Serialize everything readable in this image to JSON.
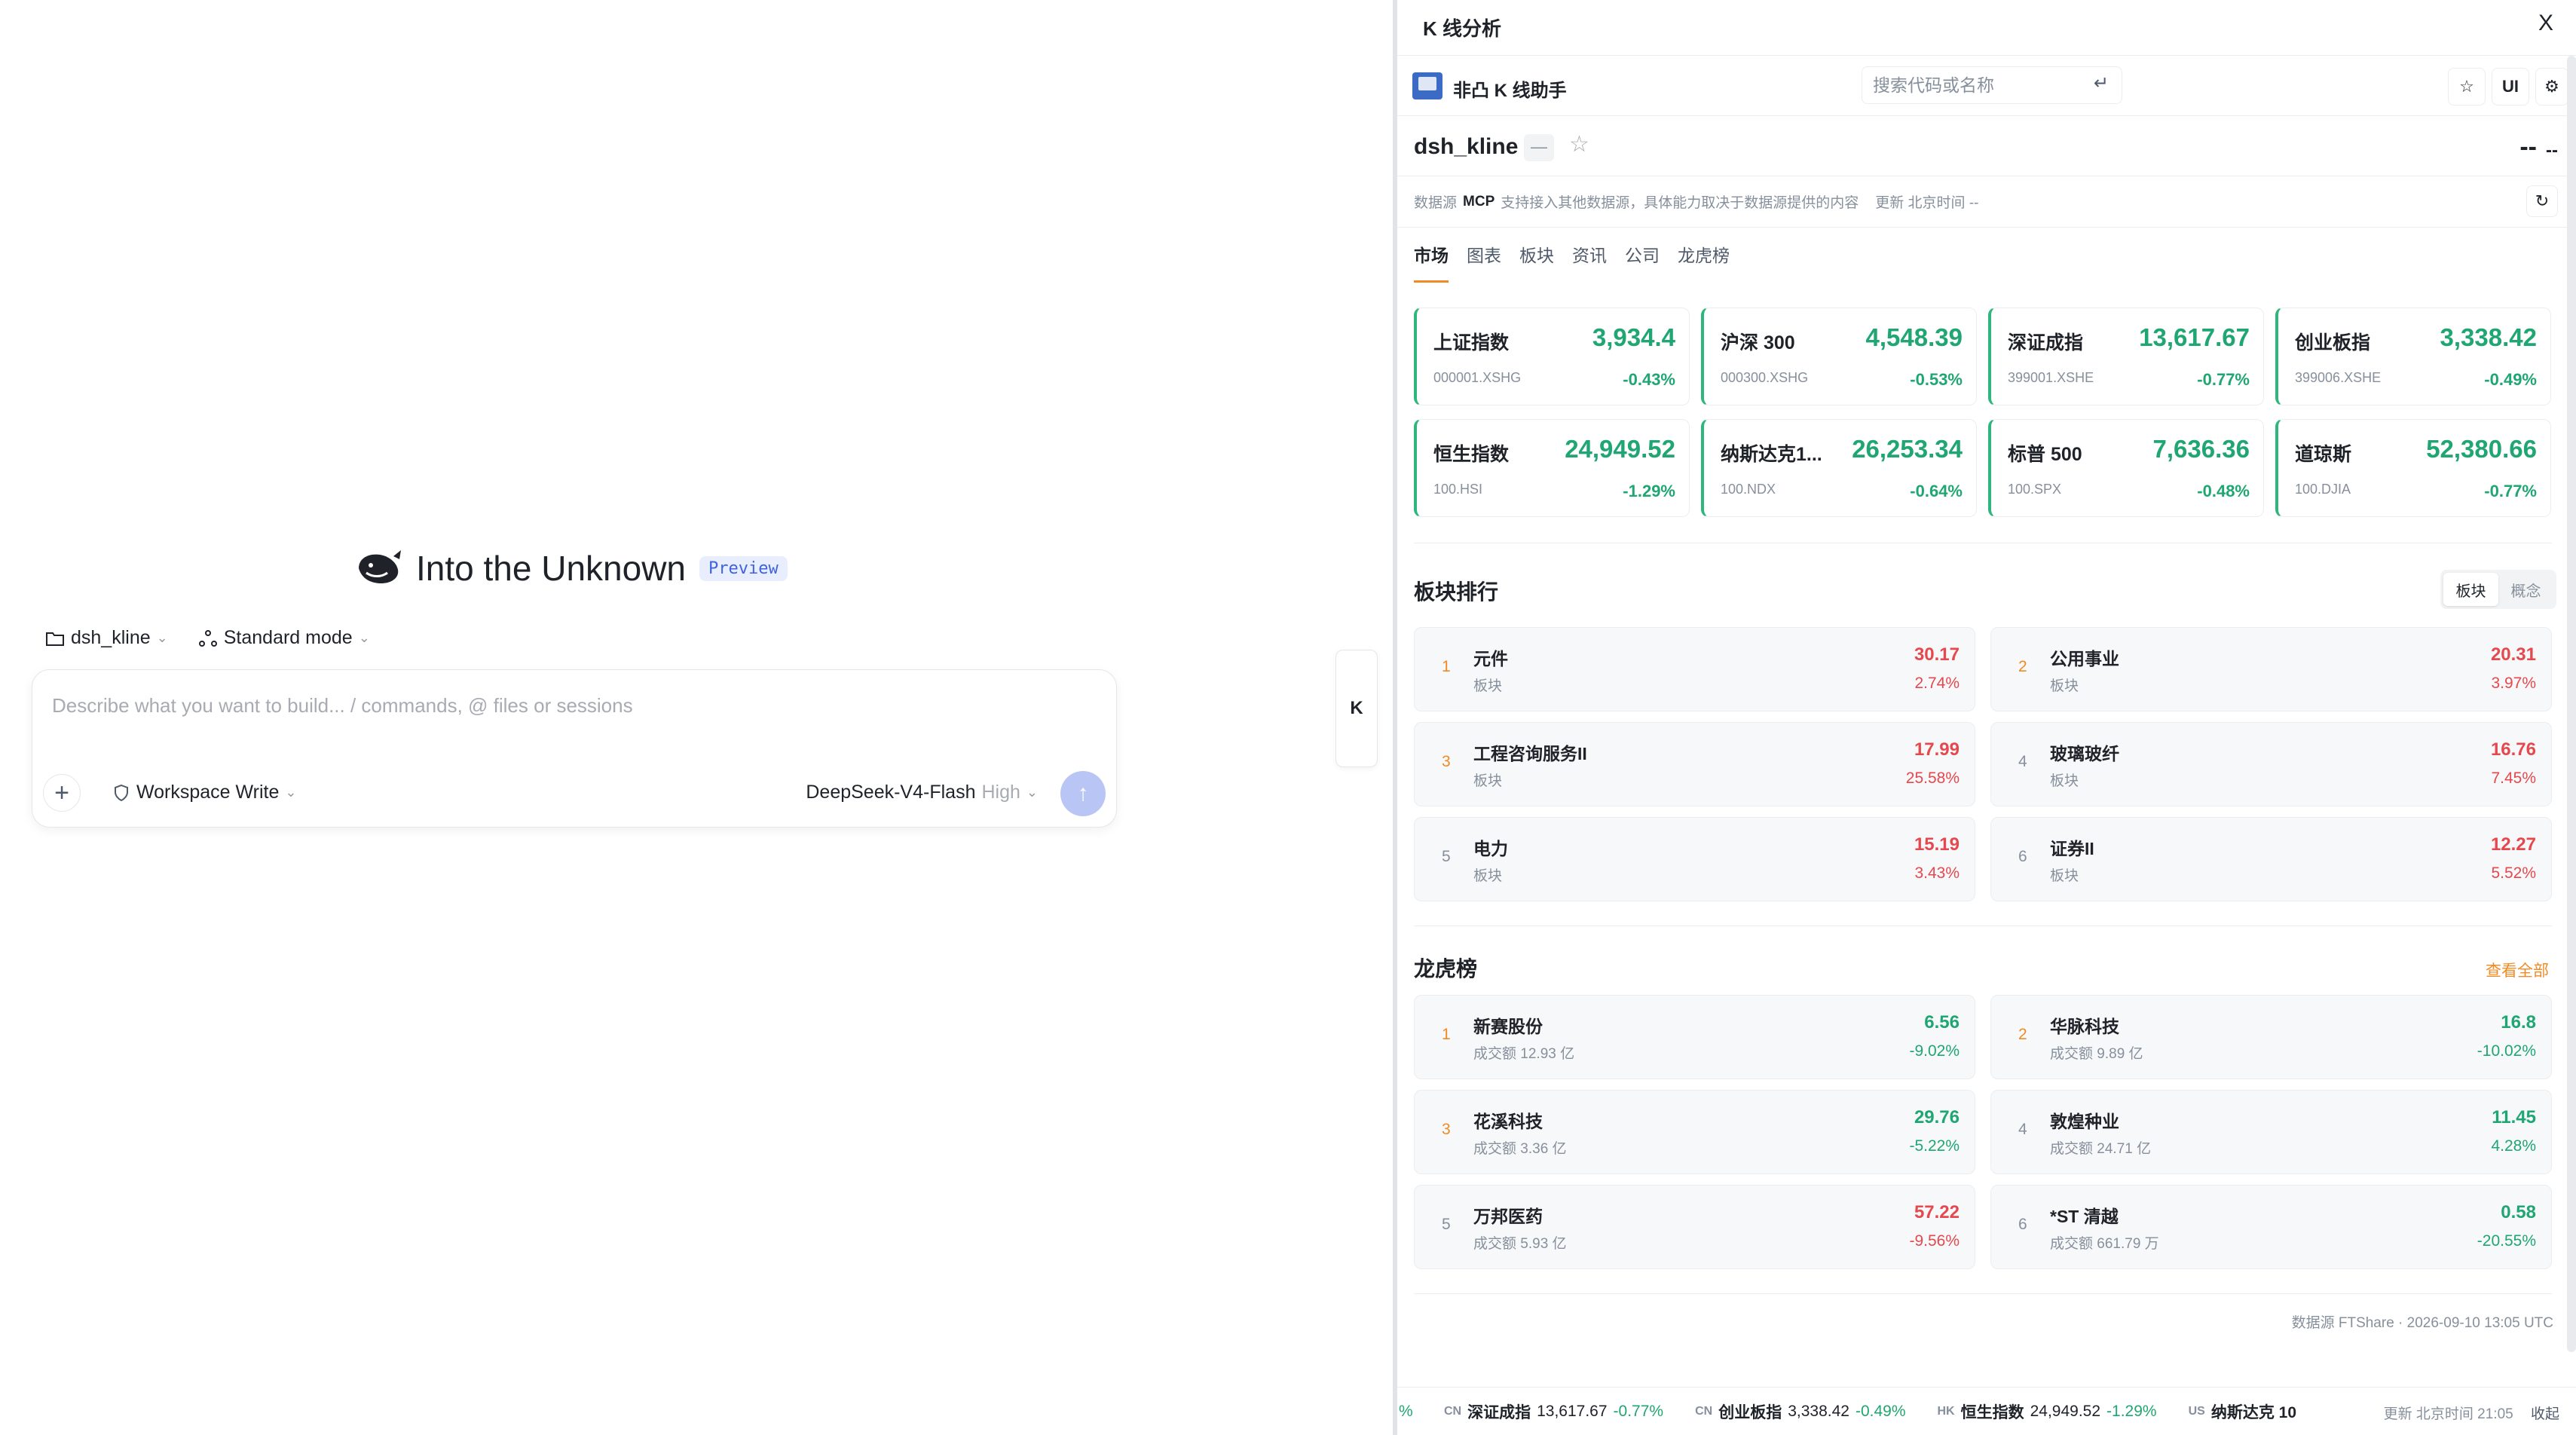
{
  "left": {
    "hero_title": "Into the Unknown",
    "preview_badge": "Preview",
    "project_chip": "dsh_kline",
    "mode_chip": "Standard mode",
    "composer_placeholder": "Describe what you want to build... / commands, @ files or sessions",
    "workspace_chip": "Workspace Write",
    "model_name": "DeepSeek-V4-Flash",
    "model_level": "High",
    "side_tab": "K"
  },
  "panel": {
    "title": "K 线分析",
    "close": "X",
    "brand": "非凸 K 线助手",
    "search_placeholder": "搜索代码或名称",
    "ui_button": "UI",
    "symbol": "dsh_kline",
    "symbol_dash": "—",
    "price_big": "--",
    "price_small": "--",
    "source_label": "数据源",
    "source_value": "MCP",
    "source_note": "支持接入其他数据源，具体能力取决于数据源提供的内容",
    "update_label": "更新 北京时间 --",
    "tabs": [
      "市场",
      "图表",
      "板块",
      "资讯",
      "公司",
      "龙虎榜"
    ],
    "indices": [
      {
        "name": "上证指数",
        "value": "3,934.4",
        "code": "000001.XSHG",
        "pct": "-0.43%"
      },
      {
        "name": "沪深 300",
        "value": "4,548.39",
        "code": "000300.XSHG",
        "pct": "-0.53%"
      },
      {
        "name": "深证成指",
        "value": "13,617.67",
        "code": "399001.XSHE",
        "pct": "-0.77%"
      },
      {
        "name": "创业板指",
        "value": "3,338.42",
        "code": "399006.XSHE",
        "pct": "-0.49%"
      },
      {
        "name": "恒生指数",
        "value": "24,949.52",
        "code": "100.HSI",
        "pct": "-1.29%"
      },
      {
        "name": "纳斯达克1...",
        "value": "26,253.34",
        "code": "100.NDX",
        "pct": "-0.64%"
      },
      {
        "name": "标普 500",
        "value": "7,636.36",
        "code": "100.SPX",
        "pct": "-0.48%"
      },
      {
        "name": "道琼斯",
        "value": "52,380.66",
        "code": "100.DJIA",
        "pct": "-0.77%"
      }
    ],
    "sector_title": "板块排行",
    "sector_seg": [
      "板块",
      "概念"
    ],
    "sectors": [
      {
        "rank": "1",
        "name": "元件",
        "sub": "板块",
        "value": "30.17",
        "pct": "2.74%",
        "dir": "up"
      },
      {
        "rank": "2",
        "name": "公用事业",
        "sub": "板块",
        "value": "20.31",
        "pct": "3.97%",
        "dir": "up"
      },
      {
        "rank": "3",
        "name": "工程咨询服务II",
        "sub": "板块",
        "value": "17.99",
        "pct": "25.58%",
        "dir": "up"
      },
      {
        "rank": "4",
        "name": "玻璃玻纤",
        "sub": "板块",
        "value": "16.76",
        "pct": "7.45%",
        "dir": "up"
      },
      {
        "rank": "5",
        "name": "电力",
        "sub": "板块",
        "value": "15.19",
        "pct": "3.43%",
        "dir": "up"
      },
      {
        "rank": "6",
        "name": "证券II",
        "sub": "板块",
        "value": "12.27",
        "pct": "5.52%",
        "dir": "up"
      }
    ],
    "lhb_title": "龙虎榜",
    "lhb_viewall": "查看全部",
    "lhb": [
      {
        "rank": "1",
        "name": "新赛股份",
        "sub": "成交额 12.93 亿",
        "value": "6.56",
        "pct": "-9.02%",
        "dir": "dn"
      },
      {
        "rank": "2",
        "name": "华脉科技",
        "sub": "成交额 9.89 亿",
        "value": "16.8",
        "pct": "-10.02%",
        "dir": "dn"
      },
      {
        "rank": "3",
        "name": "花溪科技",
        "sub": "成交额 3.36 亿",
        "value": "29.76",
        "pct": "-5.22%",
        "dir": "dn"
      },
      {
        "rank": "4",
        "name": "敦煌种业",
        "sub": "成交额 24.71 亿",
        "value": "11.45",
        "pct": "4.28%",
        "dir": "dn"
      },
      {
        "rank": "5",
        "name": "万邦医药",
        "sub": "成交额 5.93 亿",
        "value": "57.22",
        "pct": "-9.56%",
        "dir": "up"
      },
      {
        "rank": "6",
        "name": "*ST 清越",
        "sub": "成交额 661.79 万",
        "value": "0.58",
        "pct": "-20.55%",
        "dir": "dn"
      }
    ],
    "footnote": "数据源 FTShare · 2026-09-10 13:05 UTC",
    "ticker": [
      {
        "mkt": "CN",
        "name": "深证成指",
        "value": "13,617.67",
        "pct": "-0.77%"
      },
      {
        "mkt": "CN",
        "name": "创业板指",
        "value": "3,338.42",
        "pct": "-0.49%"
      },
      {
        "mkt": "HK",
        "name": "恒生指数",
        "value": "24,949.52",
        "pct": "-1.29%"
      },
      {
        "mkt": "US",
        "name": "纳斯达克 10",
        "value": "",
        "pct": ""
      }
    ],
    "ticker_update": "更新 北京时间 21:05",
    "ticker_collapse": "收起"
  },
  "colors": {
    "up": "#e5484d",
    "down": "#1fa672",
    "accent": "#f08a24",
    "brand": "#3b6bc4"
  }
}
